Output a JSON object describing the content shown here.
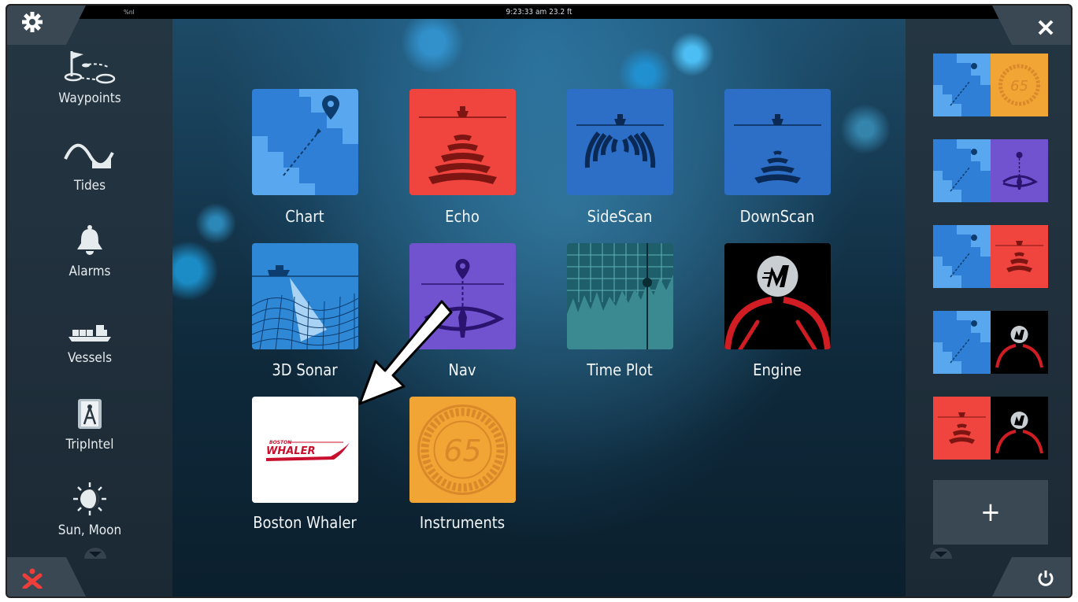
{
  "status_bar": {
    "signal": "%nl",
    "time_depth": "9:23:33 am   23.2 ft"
  },
  "left_menu": {
    "items": [
      {
        "label": "Waypoints",
        "icon": "waypoints-icon"
      },
      {
        "label": "Tides",
        "icon": "tides-wave-icon"
      },
      {
        "label": "Alarms",
        "icon": "bell-icon"
      },
      {
        "label": "Vessels",
        "icon": "vessels-icon"
      },
      {
        "label": "TripIntel",
        "icon": "tripintel-compass-icon"
      },
      {
        "label": "Sun, Moon",
        "icon": "sun-moon-icon"
      }
    ]
  },
  "apps": [
    {
      "label": "Chart",
      "color": "#2f7fd6"
    },
    {
      "label": "Echo",
      "color": "#f0443f"
    },
    {
      "label": "SideScan",
      "color": "#2d6fc7"
    },
    {
      "label": "DownScan",
      "color": "#2d6fc7"
    },
    {
      "label": "3D Sonar",
      "color": "#2f88d6"
    },
    {
      "label": "Nav",
      "color": "#7253cf"
    },
    {
      "label": "Time Plot",
      "color": "#1e5f6b"
    },
    {
      "label": "Engine",
      "color": "#000000"
    },
    {
      "label": "Boston Whaler",
      "color": "#ffffff",
      "logo_top": "BOSTON",
      "logo_bottom": "WHALER"
    },
    {
      "label": "Instruments",
      "color": "#f0a534",
      "value": "65"
    }
  ],
  "favorites": [
    {
      "panes": [
        "chart",
        "instruments"
      ]
    },
    {
      "panes": [
        "chart",
        "nav"
      ]
    },
    {
      "panes": [
        "chart",
        "echo"
      ]
    },
    {
      "panes": [
        "chart",
        "engine"
      ]
    },
    {
      "panes": [
        "echo",
        "engine"
      ]
    }
  ],
  "add_button": "+",
  "instrument_value": "65"
}
